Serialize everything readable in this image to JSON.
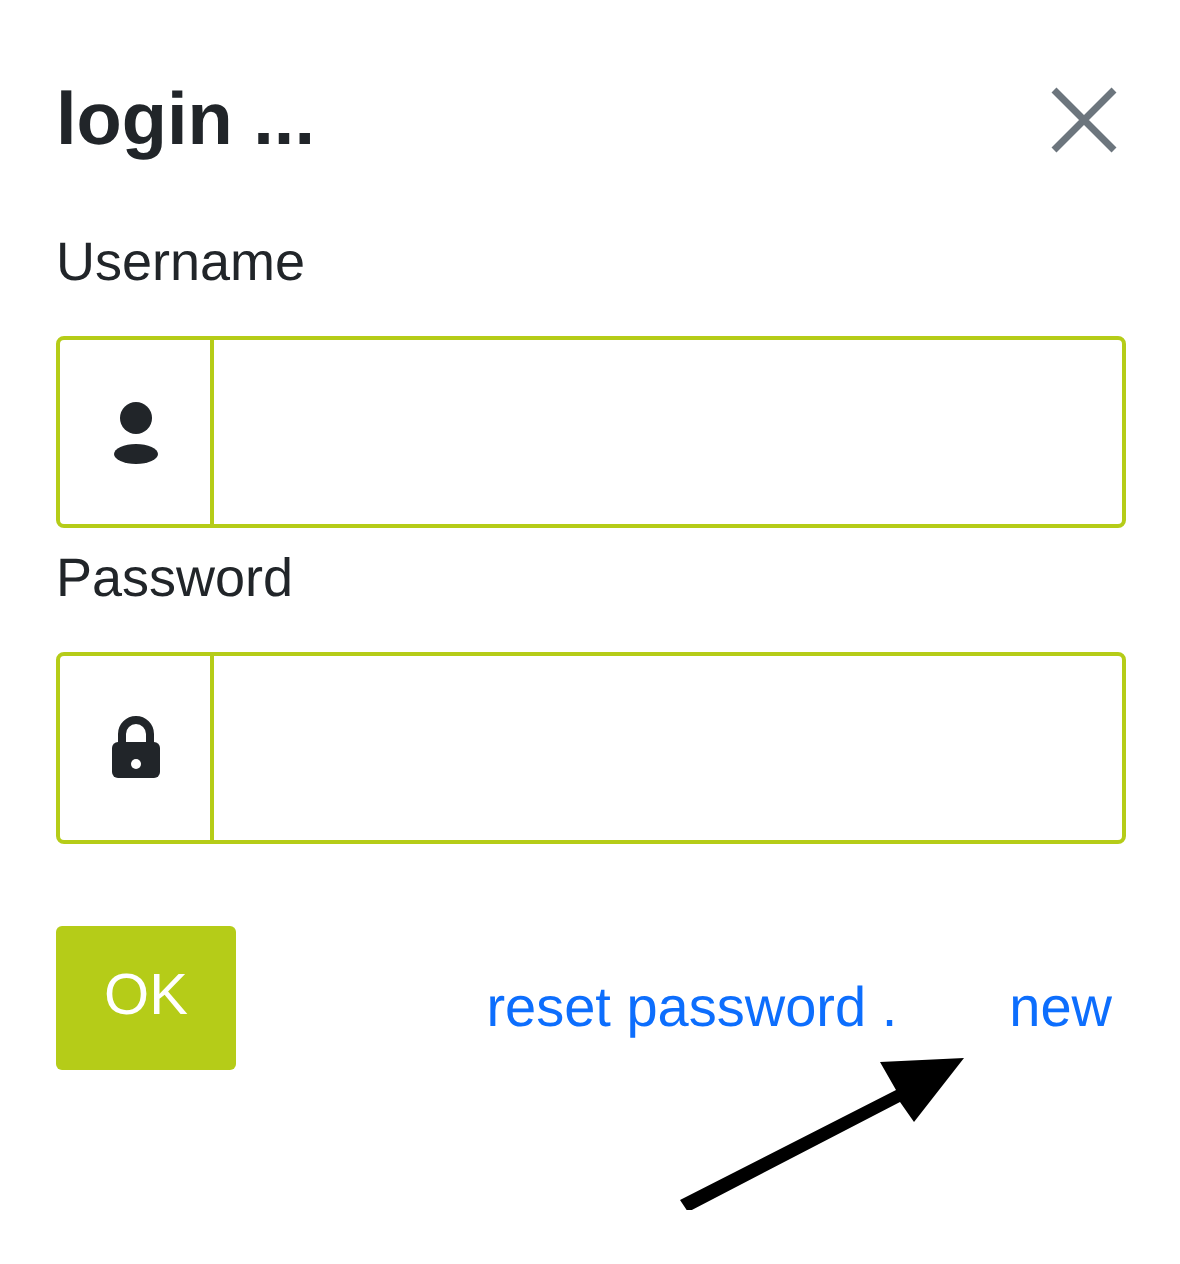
{
  "dialog": {
    "title": "login ..."
  },
  "fields": [
    {
      "label": "Username",
      "kind": "user"
    },
    {
      "label": "Password",
      "kind": "lock"
    }
  ],
  "ok_button": "OK",
  "links": [
    "reset password .",
    "new"
  ]
}
